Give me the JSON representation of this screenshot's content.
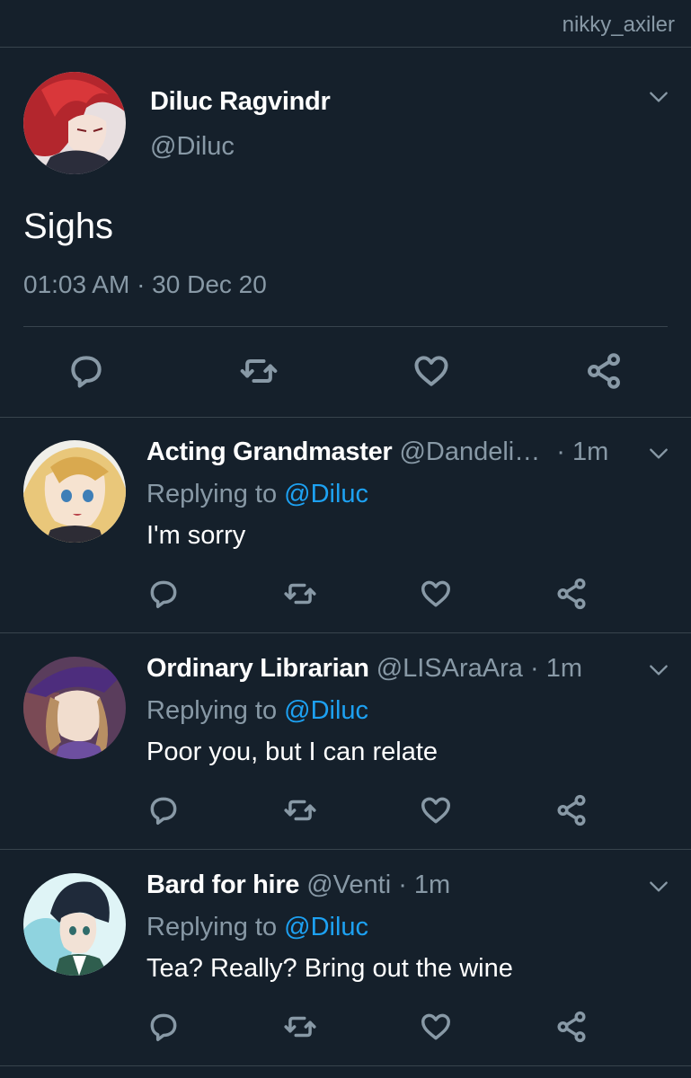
{
  "watermark": "nikky_axiler",
  "main_tweet": {
    "display_name": "Diluc Ragvindr",
    "handle": "@Diluc",
    "text": "Sighs",
    "timestamp": "01:03 AM · 30 Dec 20"
  },
  "replies": [
    {
      "display_name": "Acting Grandmaster",
      "handle": "@Dandeli…",
      "time": "· 1m",
      "replying_prefix": "Replying to",
      "replying_to": "@Diluc",
      "text": "I'm sorry"
    },
    {
      "display_name": "Ordinary Librarian",
      "handle": "@LISAraAra",
      "time": "· 1m",
      "replying_prefix": "Replying to",
      "replying_to": "@Diluc",
      "text": "Poor you, but I can relate"
    },
    {
      "display_name": "Bard for hire",
      "handle": "@Venti",
      "time": "· 1m",
      "replying_prefix": "Replying to",
      "replying_to": "@Diluc",
      "text": "Tea? Really? Bring out the wine"
    }
  ],
  "icons": {
    "reply": "reply-icon",
    "retweet": "retweet-icon",
    "like": "heart-icon",
    "share": "share-icon",
    "more": "chevron-down-icon"
  },
  "colors": {
    "background": "#15202b",
    "separator": "#38444d",
    "secondary_text": "#8899a6",
    "mention": "#1da1f2"
  }
}
